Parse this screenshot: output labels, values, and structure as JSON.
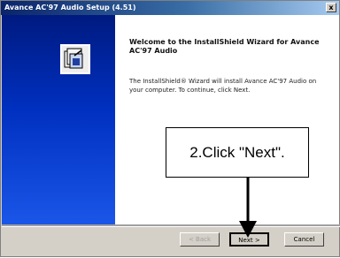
{
  "window": {
    "title": "Avance AC'97 Audio Setup (4.51)",
    "close_label": "x"
  },
  "dialog": {
    "heading": "Welcome to the InstallShield Wizard for Avance AC'97 Audio",
    "description": "The InstallShield® Wizard will install Avance AC'97 Audio on your computer. To continue, click Next.",
    "setup_icon": "installer-box-icon"
  },
  "buttons": {
    "back_label": "< Back",
    "next_label": "Next >",
    "cancel_label": "Cancel"
  },
  "annotation": {
    "text": "2.Click \"Next\".",
    "arrow_icon": "down-arrow-icon"
  },
  "colors": {
    "banner_top": "#001a80",
    "banner_bottom": "#1a56e8",
    "dialog_face": "#d4d0c8"
  }
}
